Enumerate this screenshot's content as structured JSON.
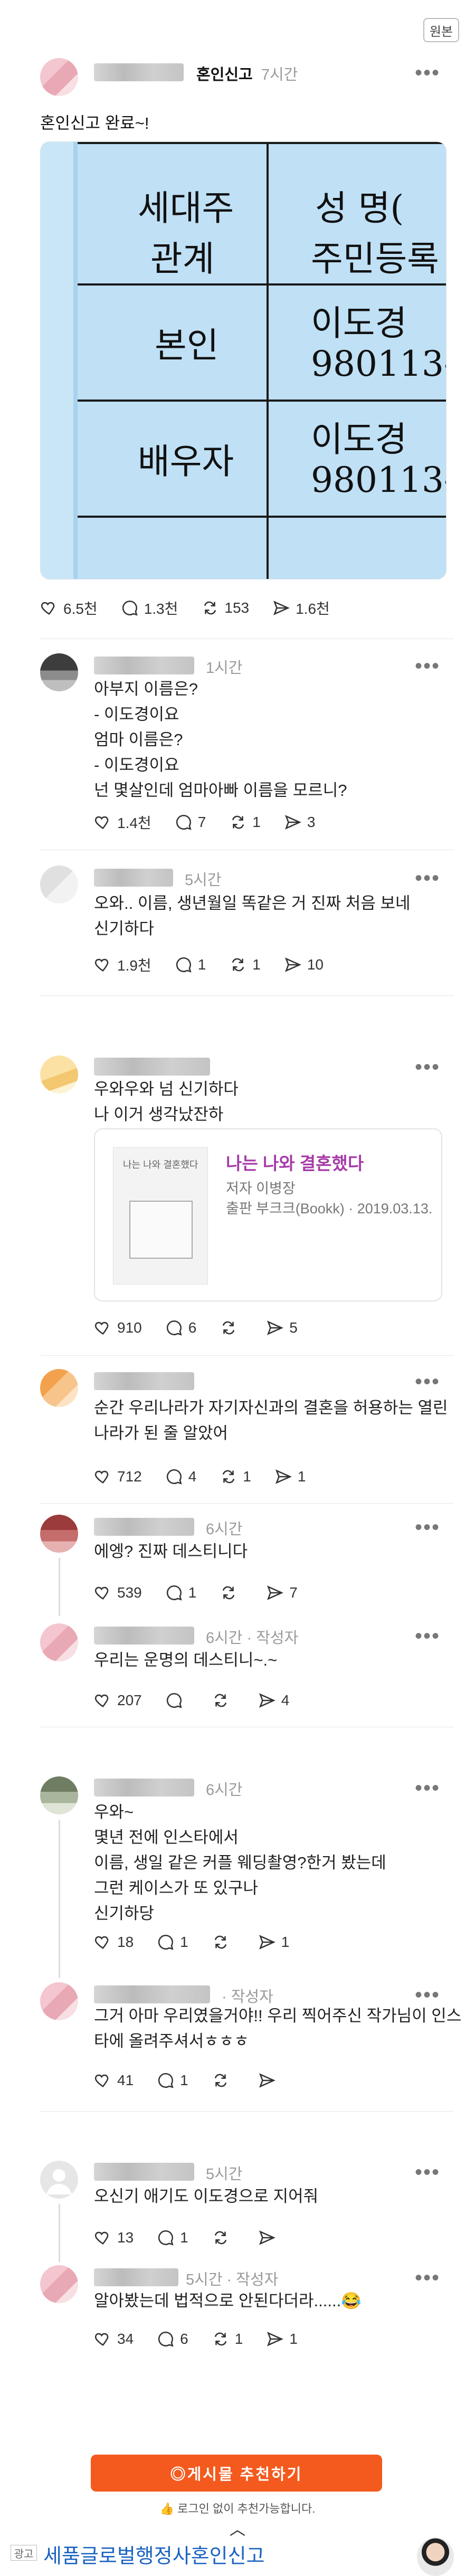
{
  "header": {
    "original_button": "원본"
  },
  "main_post": {
    "board": "혼인신고",
    "time": "7시간",
    "text": "혼인신고 완료~!",
    "document": {
      "col1_row1": "세대주",
      "col1_row2": "관계",
      "col2_row1": "성   명(",
      "col2_row2": "주민등록",
      "row1_label": "본인",
      "row1_name": "이도경",
      "row1_id": "980113-",
      "row2_label": "배우자",
      "row2_name": "이도경",
      "row2_id": "980113-"
    },
    "stats": {
      "likes": "6.5천",
      "comments": "1.3천",
      "reposts": "153",
      "shares": "1.6천"
    }
  },
  "comments": [
    {
      "time": "1시간",
      "author_tag": "",
      "text": "아부지 이름은?\n- 이도경이요\n엄마 이름은?\n- 이도경이요\n넌 몇살인데 엄마아빠 이름을 모르니?",
      "likes": "1.4천",
      "comments": "7",
      "reposts": "1",
      "shares": "3"
    },
    {
      "time": "5시간",
      "author_tag": "",
      "text": "오와.. 이름, 생년월일 똑같은 거 진짜 처음 보네\n신기하다",
      "likes": "1.9천",
      "comments": "1",
      "reposts": "1",
      "shares": "10"
    },
    {
      "time": "",
      "author_tag": "",
      "text": "우와우와 넘 신기하다\n나 이거 생각났잔하",
      "book": {
        "cover_text": "나는 나와 결혼했다",
        "title": "나는 나와 결혼했다",
        "author": "저자 이병장",
        "publisher": "출판 부크크(Bookk) · 2019.03.13."
      },
      "likes": "910",
      "comments": "6",
      "reposts": "",
      "shares": "5"
    },
    {
      "time": "",
      "author_tag": "",
      "text": "순간 우리나라가 자기자신과의 결혼을 허용하는 열린\n나라가 된 줄 알았어",
      "likes": "712",
      "comments": "4",
      "reposts": "1",
      "shares": "1"
    },
    {
      "time": "6시간",
      "author_tag": "",
      "text": "에엥? 진짜 데스티니다",
      "likes": "539",
      "comments": "1",
      "reposts": "",
      "shares": "7"
    },
    {
      "time": "6시간",
      "author_tag": "작성자",
      "text": "우리는 운명의 데스티니~.~",
      "likes": "207",
      "comments": "",
      "reposts": "",
      "shares": "4"
    },
    {
      "time": "6시간",
      "author_tag": "",
      "text": "우와~\n몇년 전에 인스타에서\n이름, 생일 같은 커플 웨딩촬영?한거 봤는데\n그런 케이스가 또 있구나\n신기하당",
      "likes": "18",
      "comments": "1",
      "reposts": "",
      "shares": "1"
    },
    {
      "time": "",
      "author_tag": "작성자",
      "text": "그거 아마 우리였을거야!! 우리 찍어주신 작가님이 인스\n타에 올려주셔서ㅎㅎㅎ",
      "likes": "41",
      "comments": "1",
      "reposts": "",
      "shares": ""
    },
    {
      "time": "5시간",
      "author_tag": "",
      "text": "오신기 애기도 이도경으로 지어줘",
      "likes": "13",
      "comments": "1",
      "reposts": "",
      "shares": ""
    },
    {
      "time": "5시간",
      "author_tag": "작성자",
      "text": "알아봤는데 법적으로 안된다더라......😂",
      "likes": "34",
      "comments": "6",
      "reposts": "1",
      "shares": "1"
    }
  ],
  "footer": {
    "recommend_button": "◎게시물 추천하기",
    "recommend_note": "로그인 없이 추천가능합니다.",
    "ad_label": "광고",
    "ad_text": "세품글로벌행정사혼인신고"
  },
  "colors": {
    "accent": "#f45a1e",
    "ad_link": "#1b63c2",
    "book_title": "#a63aa8"
  }
}
